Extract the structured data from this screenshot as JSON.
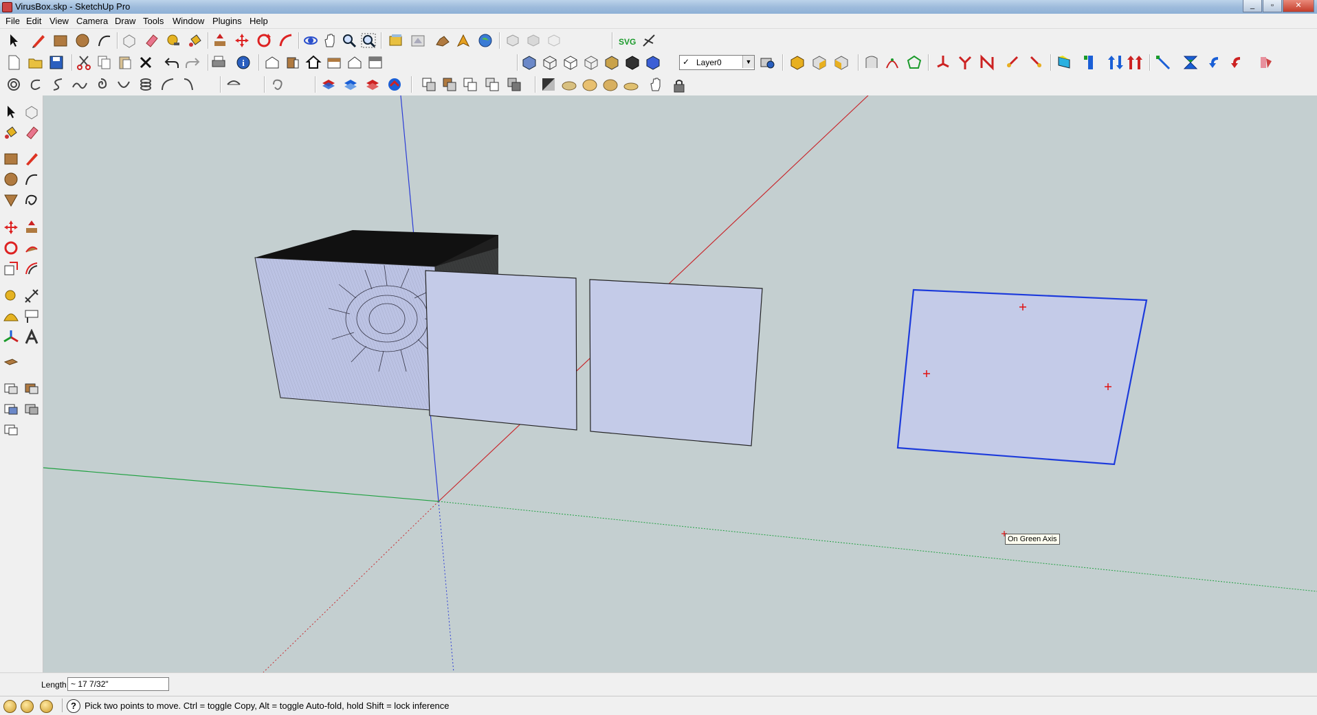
{
  "window": {
    "title": "VirusBox.skp - SketchUp Pro",
    "minimize": "_",
    "maximize": "▫",
    "close": "✕"
  },
  "menu": [
    "File",
    "Edit",
    "View",
    "Camera",
    "Draw",
    "Tools",
    "Window",
    "Plugins",
    "Help"
  ],
  "toolbar": {
    "svg_label": "SVG"
  },
  "layer": {
    "selected": "Layer0",
    "checked": "✓"
  },
  "viewport": {
    "tooltip": "On Green Axis"
  },
  "vcb": {
    "label": "Length",
    "value": "~ 17 7/32\""
  },
  "status": {
    "help": "?",
    "message": "Pick two points to move.  Ctrl = toggle Copy, Alt = toggle Auto-fold, hold Shift = lock inference"
  },
  "colors": {
    "viewport_bg": "#c4cfd0",
    "face": "#c4cbe8",
    "axis_red": "#c8282d",
    "axis_green": "#1fa040",
    "axis_blue": "#2a3bd6",
    "selection": "#1c3adb"
  }
}
